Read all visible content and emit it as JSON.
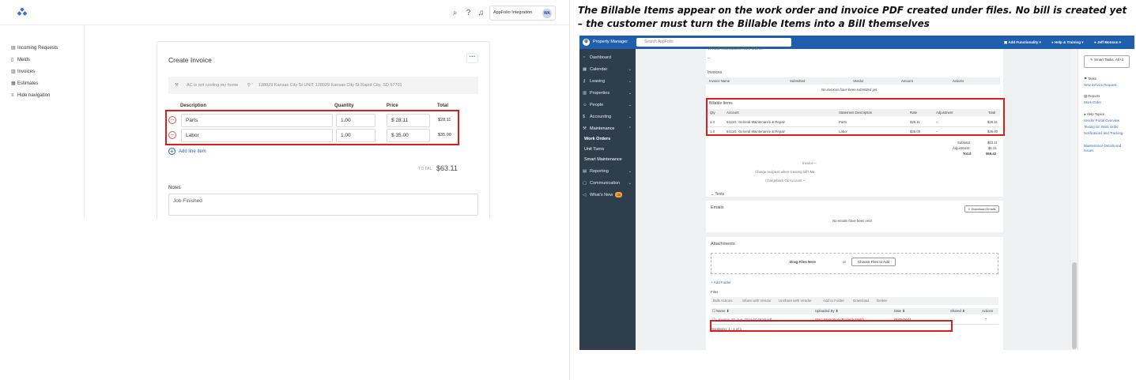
{
  "caption": "The Billable Items appear on the work order and invoice PDF created under files. No bill is created yet – the customer must turn the Billable Items into a Bill themselves",
  "meld": {
    "topbar": {
      "integration_label": "AppFolio Integration",
      "avatar": "WA"
    },
    "nav": [
      {
        "label": "Incoming Requests",
        "icon": "inbox-icon"
      },
      {
        "label": "Melds",
        "icon": "file-icon"
      },
      {
        "label": "Invoices",
        "icon": "invoice-icon"
      },
      {
        "label": "Estimates",
        "icon": "estimate-icon"
      },
      {
        "label": "Hide navigation",
        "icon": "collapse-icon"
      }
    ],
    "card": {
      "title": "Create Invoice",
      "meld_title": "AC is not cooling my home",
      "address": "128029 Kansas City St UNIT 128029 Kansas City St Rapid City, SD 57701",
      "columns": {
        "description": "Description",
        "quantity": "Quantity",
        "price": "Price",
        "total": "Total"
      },
      "line_items": [
        {
          "description": "Parts",
          "quantity": "1.00",
          "price": "$ 28.11",
          "total": "$28.11"
        },
        {
          "description": "Labor",
          "quantity": "1.00",
          "price": "$ 35.00",
          "total": "$35.00"
        }
      ],
      "add_line_item": "Add line item",
      "total_label": "TOTAL",
      "total_value": "$63.11",
      "notes_label": "Notes",
      "notes_value": "Job Finished"
    }
  },
  "appfolio": {
    "brand": "Property Manager",
    "search_placeholder": "Search AppFolio",
    "top_right": {
      "add_functionality": "Add Functionality",
      "help": "Help & Training",
      "user": "Jeff Monson"
    },
    "nav": [
      {
        "label": "Dashboard",
        "icon": "dashboard-icon",
        "chevron": false
      },
      {
        "label": "Calendar",
        "icon": "calendar-icon",
        "chevron": true
      },
      {
        "label": "Leasing",
        "icon": "key-icon",
        "chevron": true
      },
      {
        "label": "Properties",
        "icon": "building-icon",
        "chevron": true
      },
      {
        "label": "People",
        "icon": "people-icon",
        "chevron": true
      },
      {
        "label": "Accounting",
        "icon": "dollar-icon",
        "chevron": true
      },
      {
        "label": "Maintenance",
        "icon": "wrench-icon",
        "chevron": true
      }
    ],
    "maintenance_sub": [
      "Work Orders",
      "Unit Turns",
      "Smart Maintenance"
    ],
    "nav_bottom": [
      {
        "label": "Reporting",
        "icon": "report-icon",
        "chevron": true
      },
      {
        "label": "Communication",
        "icon": "chat-icon",
        "chevron": true
      },
      {
        "label": "What's New",
        "icon": "megaphone-icon",
        "badge": "29"
      }
    ],
    "cropped_heading": "Vendor Instructions from Owner",
    "cropped_dash": "--",
    "invoices": {
      "title": "Invoices",
      "columns": [
        "Invoice Name",
        "Submitted",
        "Vendor",
        "Amount",
        "Actions"
      ],
      "empty": "No invoices have been submitted yet."
    },
    "billable": {
      "title": "Billable Items",
      "columns": [
        "Qty",
        "Account",
        "Statement Description",
        "Rate",
        "Adjustment",
        "Total"
      ],
      "rows": [
        {
          "qty": "1.0",
          "account": "6411G: General Maintenance & Repair",
          "desc": "Parts",
          "rate": "$28.11",
          "adj": "--",
          "total": "$28.11"
        },
        {
          "qty": "1.0",
          "account": "6411G: General Maintenance & Repair",
          "desc": "Labor",
          "rate": "$35.00",
          "adj": "--",
          "total": "$35.00"
        }
      ],
      "subtotal_label": "Subtotal:",
      "subtotal": "$63.11",
      "adjustment_label": "Adjustment:",
      "adjustment": "$6.31",
      "total_label": "Total:",
      "total": "$69.42"
    },
    "details": [
      {
        "label": "Invoice",
        "value": "--"
      },
      {
        "label": "Charge recipient when creating bill?",
        "value": "No"
      },
      {
        "label": "Chargeback GL Account",
        "value": "--"
      }
    ],
    "texts_label": "Texts",
    "emails": {
      "title": "Emails",
      "download": "Download Emails",
      "empty": "No emails have been sent."
    },
    "attachments": {
      "title": "Attachments",
      "drag": "Drag Files Here",
      "or": "or",
      "choose": "Choose Files to Add",
      "add_folder": "+ Add Folder",
      "files_label": "Files",
      "tabs": [
        "Bulk Actions",
        "Share with Vendor",
        "Unshare with Vendor",
        "Add to Folder",
        "Download",
        "Delete"
      ],
      "columns": [
        "Name",
        "Uploaded By",
        "Date",
        "Shared",
        "Actions"
      ],
      "file": {
        "name": "Invoice_20_Jun_2024 07:49:50.pdf",
        "uploaded_by": "Staci Integration (Property Meld)",
        "date": "06/05/2024",
        "action": "⌄"
      },
      "displaying": "Displaying: 1 - 1 of 1"
    },
    "right_panel": {
      "smart_tasks": "Smart Tasks: All+3",
      "tasks_h": "Tasks",
      "tasks_link": "New Service Request",
      "reports_h": "Reports",
      "reports_link": "Work Order",
      "help_h": "Help Topics",
      "help_links": [
        "Vendor Portal Overview",
        "Texting On Work Order",
        "Notifications and Tracking",
        "Maintenance Details and Issues"
      ]
    }
  }
}
